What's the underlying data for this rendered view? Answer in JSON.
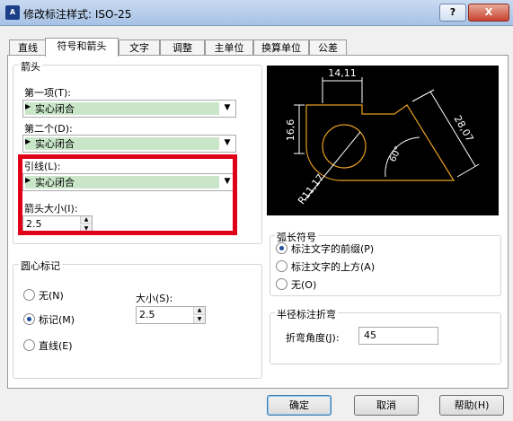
{
  "window": {
    "title": "修改标注样式: ISO-25",
    "help_btn": "?",
    "close_btn": "X",
    "app_icon": "cad-app-icon"
  },
  "tabs": [
    "直线",
    "符号和箭头",
    "文字",
    "调整",
    "主单位",
    "换算单位",
    "公差"
  ],
  "arrows": {
    "group_title": "箭头",
    "first_label": "第一项(T):",
    "first_value": "实心闭合",
    "second_label": "第二个(D):",
    "second_value": "实心闭合",
    "leader_label": "引线(L):",
    "leader_value": "实心闭合",
    "size_label": "箭头大小(I):",
    "size_value": "2.5"
  },
  "center_mark": {
    "group_title": "圆心标记",
    "none": "无(N)",
    "mark": "标记(M)",
    "line": "直线(E)",
    "size_label": "大小(S):",
    "size_value": "2.5",
    "selected": "mark"
  },
  "preview": {
    "dim_top": "14,11",
    "dim_left": "16,6",
    "dim_right": "28,07",
    "angle": "60°",
    "radius": "R11,17"
  },
  "arc_length": {
    "group_title": "弧长符号",
    "prefix": "标注文字的前缀(P)",
    "above": "标注文字的上方(A)",
    "none": "无(O)",
    "selected": "prefix"
  },
  "jog": {
    "group_title": "半径标注折弯",
    "angle_label": "折弯角度(J):",
    "angle_value": "45"
  },
  "buttons": {
    "ok": "确定",
    "cancel": "取消",
    "help": "帮助(H)"
  },
  "colors": {
    "highlight": "#e0001a",
    "combo_fill": "#c9e6c9",
    "preview_bg": "#000000",
    "preview_line": "#e8a020"
  }
}
